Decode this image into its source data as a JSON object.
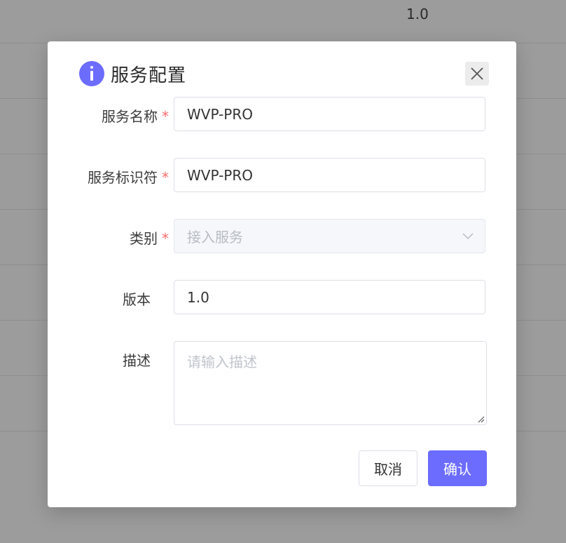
{
  "background": {
    "visible_cell": "1.0"
  },
  "dialog": {
    "title": "服务配置",
    "icon": "info-icon",
    "close_icon": "close-icon",
    "fields": {
      "service_name": {
        "label": "服务名称",
        "required_mark": "*",
        "value": "WVP-PRO"
      },
      "service_id": {
        "label": "服务标识符",
        "required_mark": "*",
        "value": "WVP-PRO"
      },
      "category": {
        "label": "类别",
        "required_mark": "*",
        "value": "接入服务",
        "disabled": true
      },
      "version": {
        "label": "版本",
        "value": "1.0"
      },
      "description": {
        "label": "描述",
        "placeholder": "请输入描述"
      }
    },
    "buttons": {
      "cancel": "取消",
      "confirm": "确认"
    }
  },
  "colors": {
    "accent": "#6c6cff",
    "required": "#f56c6c"
  }
}
